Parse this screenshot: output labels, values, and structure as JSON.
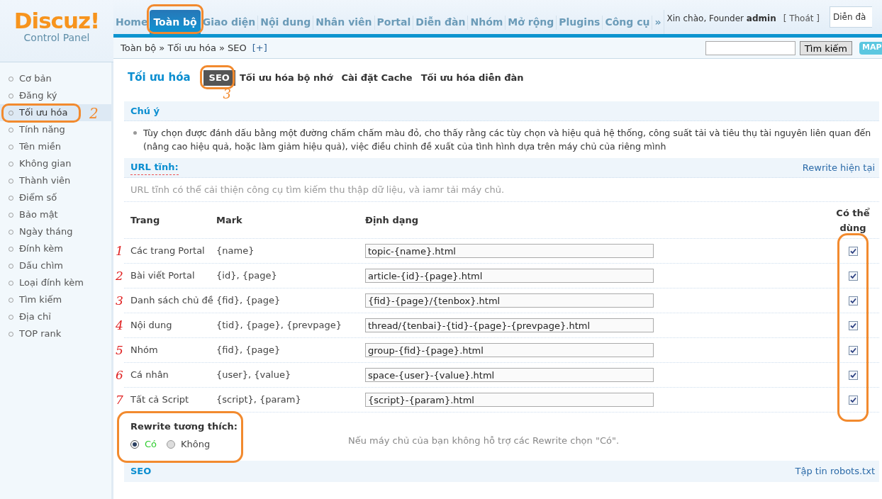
{
  "logo": {
    "name": "Discuz!",
    "subtitle": "Control Panel"
  },
  "nav": [
    {
      "label": "Home",
      "selected": false
    },
    {
      "label": "Toàn bộ",
      "selected": true,
      "highlighted": true
    },
    {
      "label": "Giao diện",
      "selected": false
    },
    {
      "label": "Nội dung",
      "selected": false
    },
    {
      "label": "Nhân viên",
      "selected": false
    },
    {
      "label": "Portal",
      "selected": false
    },
    {
      "label": "Diễn đàn",
      "selected": false
    },
    {
      "label": "Nhóm",
      "selected": false
    },
    {
      "label": "Mở rộng",
      "selected": false
    },
    {
      "label": "Plugins",
      "selected": false
    },
    {
      "label": "Công cụ",
      "selected": false
    },
    {
      "label": "»",
      "selected": false
    }
  ],
  "user": {
    "greeting": "Xin chào, Founder",
    "name": "admin",
    "logout": "[ Thoát ]"
  },
  "scope_select": {
    "value": "Diễn đà"
  },
  "breadcrumb": {
    "path": "Toàn bộ » Tối ưu hóa » SEO",
    "toggle": "[+]"
  },
  "search": {
    "button": "Tìm kiếm"
  },
  "map_button": "MAP",
  "sidebar": {
    "items": [
      {
        "label": "Cơ bản",
        "selected": false
      },
      {
        "label": "Đăng ký",
        "selected": false
      },
      {
        "label": "Tối ưu hóa",
        "selected": true,
        "highlighted": true,
        "annotation": "2"
      },
      {
        "label": "Tính năng",
        "selected": false
      },
      {
        "label": "Tên miền",
        "selected": false
      },
      {
        "label": "Không gian",
        "selected": false
      },
      {
        "label": "Thành viên",
        "selected": false
      },
      {
        "label": "Điểm số",
        "selected": false
      },
      {
        "label": "Bảo mật",
        "selected": false
      },
      {
        "label": "Ngày tháng",
        "selected": false
      },
      {
        "label": "Đính kèm",
        "selected": false
      },
      {
        "label": "Dấu chìm",
        "selected": false
      },
      {
        "label": "Loại đính kèm",
        "selected": false
      },
      {
        "label": "Tìm kiếm",
        "selected": false
      },
      {
        "label": "Địa chỉ",
        "selected": false
      },
      {
        "label": "TOP rank",
        "selected": false
      }
    ]
  },
  "page_title": "Tối ưu hóa",
  "tabs": [
    {
      "label": "SEO",
      "selected": true,
      "highlighted": true,
      "annotation": "3"
    },
    {
      "label": "Tối ưu hóa bộ nhớ",
      "selected": false
    },
    {
      "label": "Cài đặt Cache",
      "selected": false
    },
    {
      "label": "Tối ưu hóa diễn đàn",
      "selected": false
    }
  ],
  "notice": {
    "title": "Chú ý",
    "items": [
      "Tùy chọn được đánh dấu bằng một đường chấm chấm màu đỏ, cho thấy rằng các tùy chọn và hiệu quả hệ thống, công suất tải và tiêu thụ tài nguyên liên quan đến (nâng cao hiệu quả, hoặc làm giảm hiệu quả), việc điều chỉnh đề xuất của tình hình dựa trên máy chủ của riêng mình"
    ]
  },
  "static_url": {
    "title": "URL tĩnh:",
    "link": "Rewrite hiện tại",
    "description": "URL tĩnh có thể cải thiện công cụ tìm kiếm thu thập dữ liệu, và iamr tải máy chủ."
  },
  "table": {
    "columns": [
      "Trang",
      "Mark",
      "Định dạng",
      "Có thể dùng"
    ],
    "checkbox_column_highlighted": true,
    "rows": [
      {
        "annotation": "1",
        "page": "Các trang Portal",
        "mark": "{name}",
        "format": "topic-{name}.html",
        "checked": true
      },
      {
        "annotation": "2",
        "page": "Bài viết Portal",
        "mark": "{id}, {page}",
        "format": "article-{id}-{page}.html",
        "checked": true
      },
      {
        "annotation": "3",
        "page": "Danh sách chủ đề",
        "mark": "{fid}, {page}",
        "format": "{fid}-{page}/{tenbox}.html",
        "checked": true
      },
      {
        "annotation": "4",
        "page": "Nội dung",
        "mark": "{tid}, {page}, {prevpage}",
        "format": "thread/{tenbai}-{tid}-{page}-{prevpage}.html",
        "checked": true
      },
      {
        "annotation": "5",
        "page": "Nhóm",
        "mark": "{fid}, {page}",
        "format": "group-{fid}-{page}.html",
        "checked": true
      },
      {
        "annotation": "6",
        "page": "Cá nhân",
        "mark": "{user}, {value}",
        "format": "space-{user}-{value}.html",
        "checked": true
      },
      {
        "annotation": "7",
        "page": "Tất cả Script",
        "mark": "{script}, {param}",
        "format": "{script}-{param}.html",
        "checked": true
      }
    ]
  },
  "rewrite_compat": {
    "label": "Rewrite tương thích:",
    "highlighted": true,
    "options": [
      {
        "label": "Có",
        "selected": true
      },
      {
        "label": "Không",
        "selected": false
      }
    ],
    "hint": "Nếu máy chủ của bạn không hỗ trợ các Rewrite chọn \"Có\"."
  },
  "seo_section": {
    "title": "SEO",
    "link": "Tập tin robots.txt"
  }
}
